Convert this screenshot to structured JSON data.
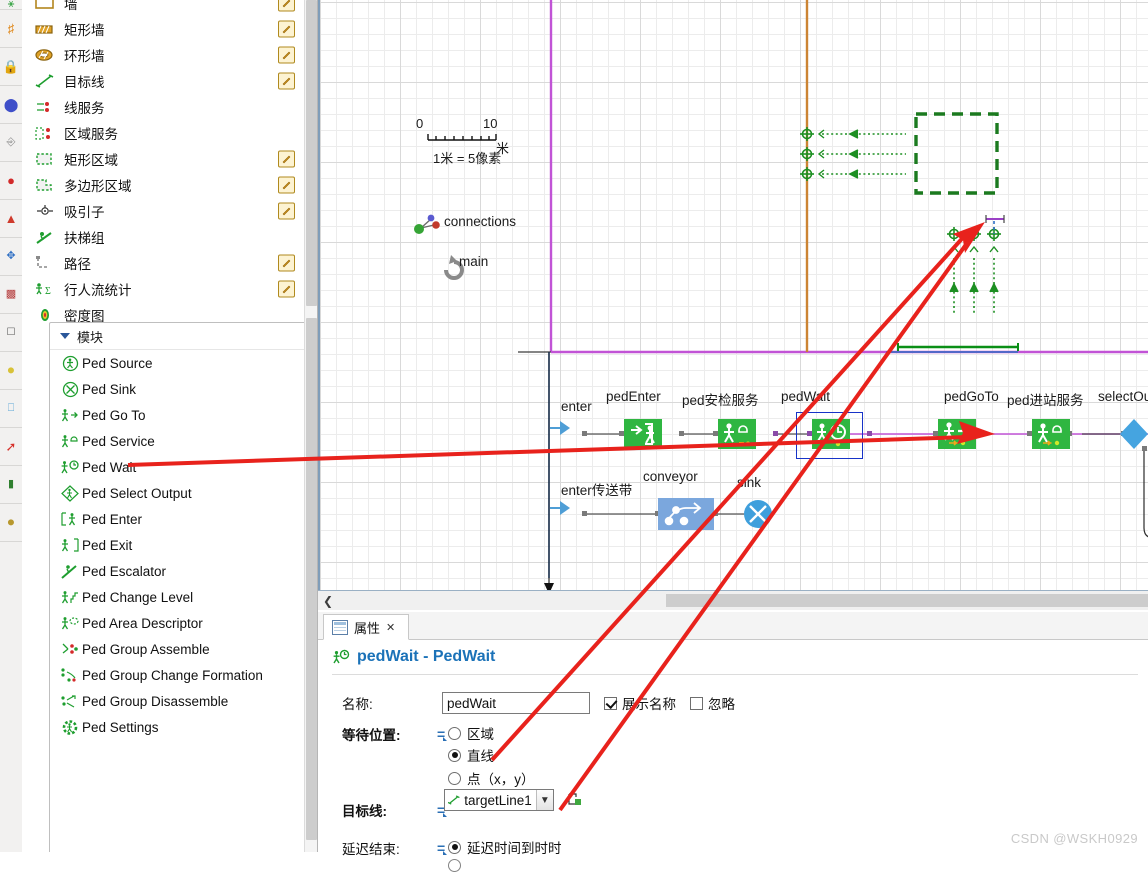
{
  "palette": {
    "items": [
      {
        "label": "墙",
        "icon": "wall-icon",
        "edit": true
      },
      {
        "label": "矩形墙",
        "icon": "rect-wall-icon",
        "edit": true
      },
      {
        "label": "环形墙",
        "icon": "ring-wall-icon",
        "edit": true
      },
      {
        "label": "目标线",
        "icon": "target-line-icon",
        "edit": true
      },
      {
        "label": "线服务",
        "icon": "line-service-icon",
        "edit": false
      },
      {
        "label": "区域服务",
        "icon": "area-service-icon",
        "edit": false
      },
      {
        "label": "矩形区域",
        "icon": "rect-area-icon",
        "edit": true
      },
      {
        "label": "多边形区域",
        "icon": "polygon-area-icon",
        "edit": true
      },
      {
        "label": "吸引子",
        "icon": "attractor-icon",
        "edit": true
      },
      {
        "label": "扶梯组",
        "icon": "escalator-group-icon",
        "edit": false
      },
      {
        "label": "路径",
        "icon": "path-icon",
        "edit": true
      },
      {
        "label": "行人流统计",
        "icon": "ped-flow-stats-icon",
        "edit": true
      },
      {
        "label": "密度图",
        "icon": "density-map-icon",
        "edit": false
      }
    ],
    "module_group": {
      "title": "模块",
      "items": [
        {
          "label": "Ped Source",
          "icon": "ped-source-icon"
        },
        {
          "label": "Ped Sink",
          "icon": "ped-sink-icon"
        },
        {
          "label": "Ped Go To",
          "icon": "ped-goto-icon"
        },
        {
          "label": "Ped Service",
          "icon": "ped-service-icon"
        },
        {
          "label": "Ped Wait",
          "icon": "ped-wait-icon"
        },
        {
          "label": "Ped Select Output",
          "icon": "ped-select-output-icon"
        },
        {
          "label": "Ped Enter",
          "icon": "ped-enter-icon"
        },
        {
          "label": "Ped Exit",
          "icon": "ped-exit-icon"
        },
        {
          "label": "Ped Escalator",
          "icon": "ped-escalator-icon"
        },
        {
          "label": "Ped Change Level",
          "icon": "ped-change-level-icon"
        },
        {
          "label": "Ped Area Descriptor",
          "icon": "ped-area-descriptor-icon"
        },
        {
          "label": "Ped Group Assemble",
          "icon": "ped-group-assemble-icon"
        },
        {
          "label": "Ped Group Change Formation",
          "icon": "ped-group-change-formation-icon"
        },
        {
          "label": "Ped Group Disassemble",
          "icon": "ped-group-disassemble-icon"
        },
        {
          "label": "Ped Settings",
          "icon": "ped-settings-icon"
        }
      ]
    }
  },
  "canvas": {
    "scale": {
      "tick_start": "0",
      "tick_end": "10",
      "unit": "米",
      "caption": "1米 = 5像素"
    },
    "annotations": [
      {
        "label": "connections",
        "icon": "connections-icon"
      },
      {
        "label": "main",
        "icon": "main-icon"
      }
    ],
    "blocks": [
      {
        "name": "enter",
        "type": "source"
      },
      {
        "name": "pedEnter",
        "type": "ped-enter"
      },
      {
        "name": "ped安检服务",
        "type": "ped-service"
      },
      {
        "name": "pedWait",
        "type": "ped-wait",
        "selected": true
      },
      {
        "name": "pedGoTo",
        "type": "ped-goto"
      },
      {
        "name": "ped进站服务",
        "type": "ped-service"
      },
      {
        "name": "selectOutp",
        "type": "select-output"
      },
      {
        "name": "enter传送带",
        "type": "source"
      },
      {
        "name": "conveyor",
        "type": "conveyor"
      },
      {
        "name": "sink",
        "type": "sink"
      }
    ],
    "colors": {
      "block_green": "#2fb641",
      "block_blue": "#7ba7dd",
      "sink_blue": "#3f9fdc",
      "select_output": "#45a4e0",
      "magenta_line": "#c153d6",
      "orange_line": "#cc8433",
      "green_line": "#0a8f16",
      "blue_line": "#2f6fc4",
      "annotation_red": "#e8221c"
    }
  },
  "properties": {
    "tab": {
      "label": "属性",
      "close": "✕"
    },
    "title": "pedWait - PedWait",
    "rows": {
      "name_label": "名称:",
      "name_value": "pedWait",
      "show_name_label": "展示名称",
      "show_name_checked": true,
      "ignore_label": "忽略",
      "ignore_checked": false,
      "wait_pos_label": "等待位置:",
      "wait_pos_options": [
        "区域",
        "直线",
        "点（x，y）"
      ],
      "wait_pos_selected": 1,
      "target_line_label": "目标线:",
      "target_line_value": "targetLine1",
      "delay_end_label": "延迟结束:",
      "delay_end_options": [
        "延迟时间到时时"
      ],
      "delay_end_selected": 0
    }
  },
  "watermark": "CSDN @WSKH0929"
}
